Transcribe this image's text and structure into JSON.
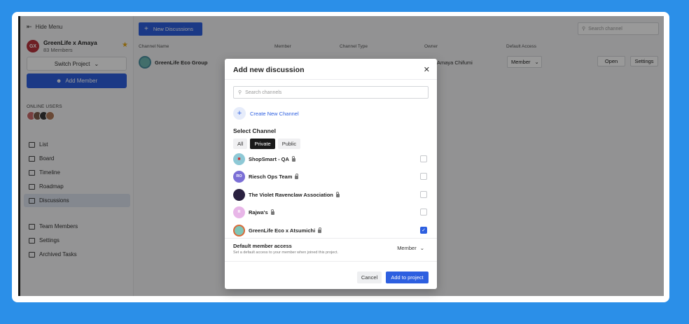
{
  "sidebar": {
    "hide_menu": "Hide Menu",
    "project": {
      "initials": "GX",
      "name": "GreenLife x Amaya",
      "members": "83 Members"
    },
    "switch_project": "Switch Project",
    "add_member": "Add Member",
    "online_users_label": "ONLINE USERS",
    "nav": [
      {
        "label": "List",
        "icon": "list-icon"
      },
      {
        "label": "Board",
        "icon": "board-icon"
      },
      {
        "label": "Timeline",
        "icon": "timeline-icon"
      },
      {
        "label": "Roadmap",
        "icon": "roadmap-icon"
      },
      {
        "label": "Discussions",
        "icon": "discussions-icon",
        "active": true
      }
    ],
    "nav2": [
      {
        "label": "Team Members",
        "icon": "team-icon"
      },
      {
        "label": "Settings",
        "icon": "gear-icon"
      },
      {
        "label": "Archived Tasks",
        "icon": "archive-icon"
      }
    ]
  },
  "main": {
    "new_discussions": "New Discussions",
    "search_placeholder": "Search channel",
    "columns": [
      "Channel Name",
      "Member",
      "Channel Type",
      "Owner",
      "Default Access"
    ],
    "row": {
      "name": "GreenLife Eco Group",
      "owner": "Amaya Chifumi",
      "access": "Member",
      "open": "Open",
      "settings": "Settings"
    }
  },
  "modal": {
    "title": "Add new discussion",
    "search_placeholder": "Search channels",
    "create_channel": "Create New Channel",
    "select_channel": "Select Channel",
    "tabs": [
      {
        "label": "All",
        "active": false
      },
      {
        "label": "Private",
        "active": true
      },
      {
        "label": "Public",
        "active": false
      }
    ],
    "channels": [
      {
        "name": "ShopSmart - QA",
        "initials": "",
        "color": "#8ec9d6",
        "checked": false
      },
      {
        "name": "Riesch Ops Team",
        "initials": "RO",
        "color": "#7b6fd6",
        "checked": false
      },
      {
        "name": "The Violet Ravenclaw Association",
        "initials": "",
        "color": "#2a2140",
        "checked": false
      },
      {
        "name": "Rajwa's",
        "initials": "R",
        "color": "#e8b6e8",
        "checked": false
      },
      {
        "name": "GreenLife Eco x Atsumichi",
        "initials": "",
        "color": "#7fc6b8",
        "checked": true
      }
    ],
    "access_title": "Default member access",
    "access_subtitle": "Set a default access to your member when joined this project.",
    "access_value": "Member",
    "cancel": "Cancel",
    "submit": "Add to project"
  }
}
